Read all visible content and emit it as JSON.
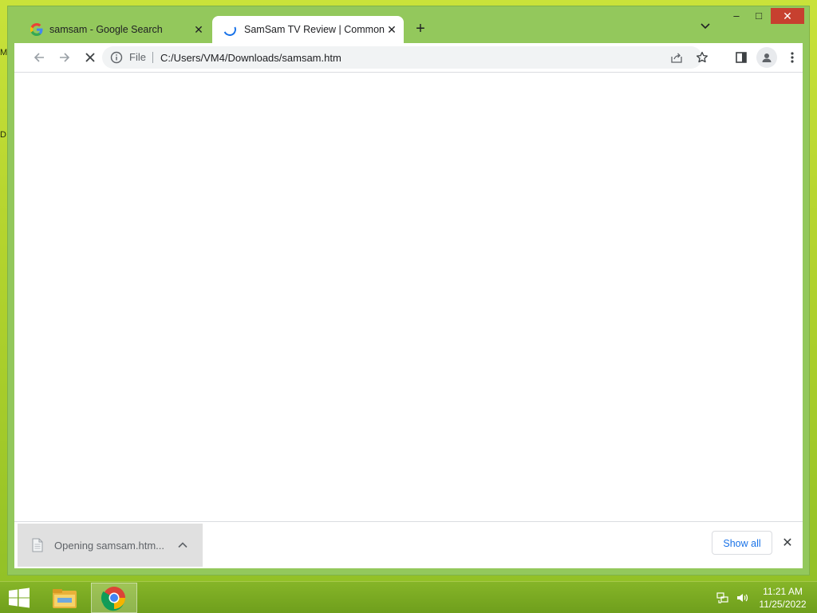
{
  "desktop": {
    "edge_letters": [
      "M",
      "D"
    ]
  },
  "browser": {
    "tabs": [
      {
        "title": "samsam - Google Search",
        "favicon": "google-g-icon",
        "active": false
      },
      {
        "title": "SamSam TV Review | Common S",
        "favicon": "loading-spinner-icon",
        "active": true
      }
    ],
    "new_tab_icon": "plus-icon",
    "tab_search_icon": "chevron-down-icon",
    "window_controls": {
      "minimize": "–",
      "maximize": "□",
      "close": "✕"
    },
    "toolbar": {
      "back_icon": "arrow-left-icon",
      "forward_icon": "arrow-right-icon",
      "stop_icon": "close-icon",
      "omnibox": {
        "scheme_label": "File",
        "url": "C:/Users/VM4/Downloads/samsam.htm"
      },
      "share_icon": "share-icon",
      "bookmark_icon": "star-icon",
      "side_panel_icon": "side-panel-icon",
      "profile_icon": "person-icon",
      "menu_icon": "kebab-menu-icon"
    },
    "download_bar": {
      "item_label": "Opening samsam.htm...",
      "show_all_label": "Show all"
    }
  },
  "taskbar": {
    "clock_time": "11:21 AM",
    "clock_date": "11/25/2022"
  },
  "colors": {
    "desktop_accent": "#b6d52f",
    "window_frame": "#93c85c",
    "close_red": "#c7402f",
    "link_blue": "#1a73e8"
  }
}
